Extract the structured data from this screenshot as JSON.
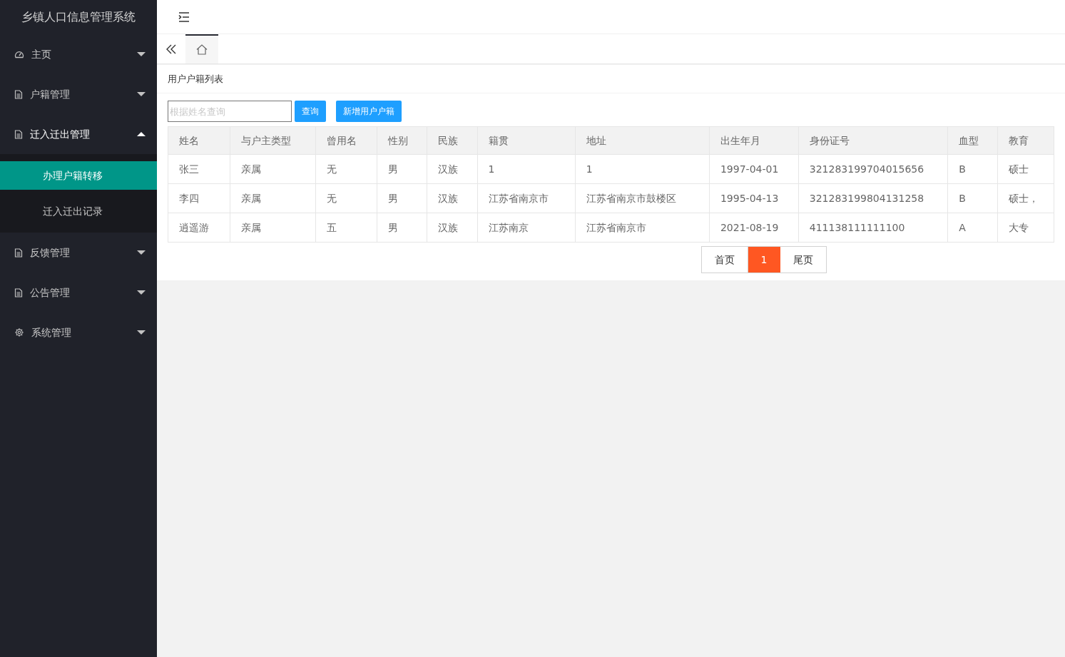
{
  "sidebar": {
    "title": "乡镇人口信息管理系统",
    "items": [
      {
        "label": "主页",
        "kind": "gauge",
        "expanded": false
      },
      {
        "label": "户籍管理",
        "kind": "doc",
        "expanded": false
      },
      {
        "label": "迁入迁出管理",
        "kind": "doc",
        "expanded": true,
        "children": [
          {
            "label": "办理户籍转移",
            "selected": true
          },
          {
            "label": "迁入迁出记录",
            "selected": false
          }
        ]
      },
      {
        "label": "反馈管理",
        "kind": "doc",
        "expanded": false
      },
      {
        "label": "公告管理",
        "kind": "doc",
        "expanded": false
      },
      {
        "label": "系统管理",
        "kind": "gear",
        "expanded": false
      }
    ]
  },
  "tabs": [
    {
      "kind": "home",
      "selected": true
    }
  ],
  "panel": {
    "title": "用户户籍列表",
    "search": {
      "placeholder": "根据姓名查询"
    },
    "buttons": [
      "查询",
      "新增用户户籍"
    ]
  },
  "table": {
    "columns": [
      "姓名",
      "与户主类型",
      "曾用名",
      "性别",
      "民族",
      "籍贯",
      "地址",
      "出生年月",
      "身份证号",
      "血型",
      "教育"
    ],
    "rows": [
      [
        "张三",
        "亲属",
        "无",
        "男",
        "汉族",
        "1",
        "1",
        "1997-04-01",
        "321283199704015656",
        "B",
        "硕士"
      ],
      [
        "李四",
        "亲属",
        "无",
        "男",
        "汉族",
        "江苏省南京市",
        "江苏省南京市鼓楼区",
        "1995-04-13",
        "321283199804131258",
        "B",
        "硕士，"
      ],
      [
        "逍遥游",
        "亲属",
        "五",
        "男",
        "汉族",
        "江苏南京",
        "江苏省南京市",
        "2021-08-19",
        "411138111111100",
        "A",
        "大专"
      ]
    ]
  },
  "pagination": {
    "first": "首页",
    "pages": [
      {
        "label": "1",
        "selected": true
      }
    ],
    "last": "尾页"
  }
}
